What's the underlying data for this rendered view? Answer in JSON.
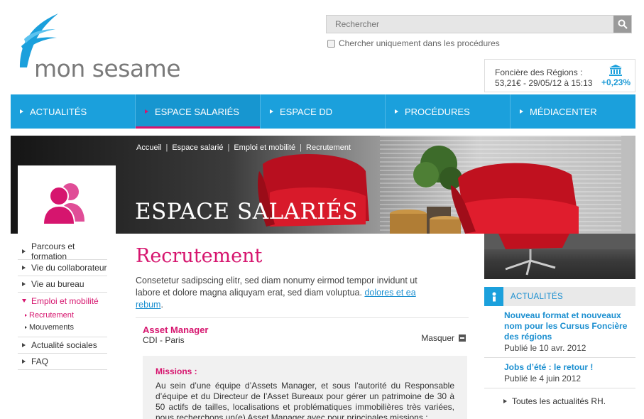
{
  "brand": {
    "name": "mon sesame",
    "accent": "#1ba0dc",
    "pink": "#d6156e"
  },
  "search": {
    "placeholder": "Rechercher",
    "only_procedures_label": "Chercher uniquement dans les procédures",
    "button_icon": "search-icon"
  },
  "stock": {
    "name": "Foncière des Régions :",
    "value": "53,21€ - 29/05/12 à 15:13",
    "change": "+0,23%",
    "icon": "bank-icon"
  },
  "nav": {
    "items": [
      {
        "label": "ACTUALITÉS"
      },
      {
        "label": "ESPACE SALARIÉS"
      },
      {
        "label": "ESPACE DD"
      },
      {
        "label": "PROCÉDURES"
      },
      {
        "label": "MÉDIACENTER"
      }
    ],
    "active_index": 1
  },
  "breadcrumb": [
    "Accueil",
    "Espace salarié",
    "Emploi et mobilité",
    "Recrutement"
  ],
  "hero": {
    "title": "ESPACE SALARIÉS",
    "profile_icon": "users-icon"
  },
  "leftmenu": {
    "items": [
      "Parcours et formation",
      "Vie du collaborateur",
      "Vie au bureau",
      "Emploi et mobilité"
    ],
    "subitems": [
      "Recrutement",
      "Mouvements"
    ],
    "items_after": [
      "Actualité sociales",
      "FAQ"
    ]
  },
  "main": {
    "title": "Recrutement",
    "intro": "Consetetur sadipscing elitr, sed diam nonumy eirmod tempor invidunt ut labore et dolore magna aliquyam erat, sed diam voluptua.",
    "intro_link": "dolores et ea rebum",
    "intro_end": "."
  },
  "job": {
    "title": "Asset Manager",
    "subtitle": "CDI - Paris",
    "toggle_label": "Masquer",
    "missions_heading": "Missions :",
    "missions_text": "Au sein d’une équipe d’Assets Manager, et sous l’autorité du Responsable d’équipe et du Directeur de l’Asset Bureaux pour gérer un patrimoine de 30 à 50 actifs de tailles, localisations et problématiques immobilières très variées, nous recherchons un(e) Asset Manager avec pour principales missions :"
  },
  "news": {
    "heading": "ACTUALITÉS",
    "items": [
      {
        "title": "Nouveau format et nouveaux nom pour les Cursus Foncière des régions",
        "date": "Publié le 10 avr. 2012"
      },
      {
        "title": "Jobs d’été : le retour !",
        "date": "Publié le 4 juin 2012"
      }
    ],
    "all_link": "Toutes les actualités RH."
  }
}
